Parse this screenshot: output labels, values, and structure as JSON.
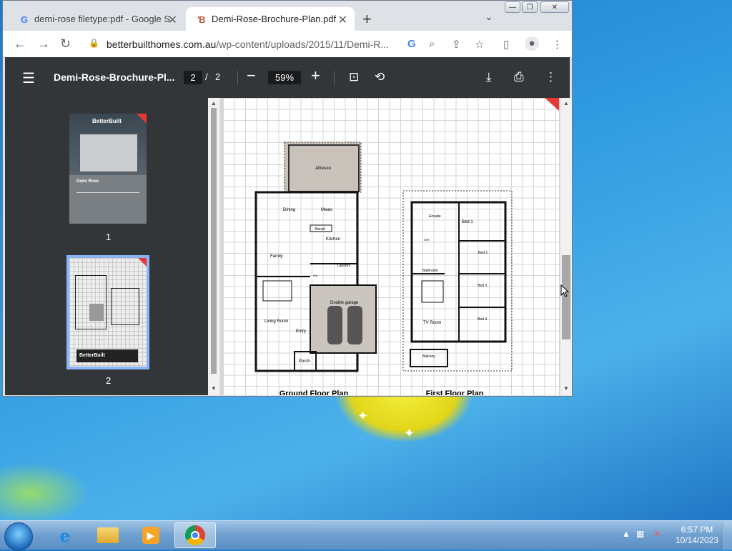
{
  "browser": {
    "tabs": [
      {
        "label": "demi-rose filetype:pdf - Google S",
        "favicon": "google-icon",
        "active": false
      },
      {
        "label": "Demi-Rose-Brochure-Plan.pdf",
        "favicon": "pdf-favicon-icon",
        "active": true
      }
    ],
    "new_tab": "+",
    "url_domain": "betterbuilthomes.com.au",
    "url_path": "/wp-content/uploads/2015/11/Demi-R..."
  },
  "pdf": {
    "title": "Demi-Rose-Brochure-Pl...",
    "current_page": "2",
    "page_separator": "/",
    "total_pages": "2",
    "zoom": "59%",
    "thumbnails": [
      {
        "label": "1",
        "brand": "BetterBuilt",
        "name": "Demi Rose"
      },
      {
        "label": "2",
        "brand": "BetterBuilt"
      }
    ],
    "plan_labels": {
      "alfresco": "Alfresco",
      "dining": "Dining",
      "meals": "Meals",
      "bench": "Bench",
      "kitchen": "Kitchen",
      "family": "Family",
      "laundry": "Laundry",
      "pdr": "Pdr",
      "double_garage": "Double garage",
      "living_room": "Living Room",
      "entry": "Entry",
      "porch": "Porch",
      "ensuite": "Ensuite",
      "wir": "WIR",
      "bed1": "Bed 1",
      "bed2": "Bed 2",
      "bed3": "Bed 3",
      "bed4": "Bed 4",
      "bathroom": "Bathroom",
      "tv_room": "TV Room",
      "balcony": "Balcony",
      "ground_floor_title": "Ground Floor Plan",
      "first_floor_title": "First Floor Plan"
    }
  },
  "taskbar": {
    "time": "6:57 PM",
    "date": "10/14/2023",
    "apps": [
      {
        "name": "internet-explorer",
        "icon": "e"
      },
      {
        "name": "file-explorer",
        "icon": "folder"
      },
      {
        "name": "media-player",
        "icon": "play"
      },
      {
        "name": "chrome",
        "icon": "chrome",
        "active": true
      }
    ]
  },
  "colors": {
    "pdf_toolbar": "#323639",
    "garage_fill": "#cbc5bf",
    "alfresco_fill": "#c9c2bb",
    "thumbnail_selected": "#8ab4f8"
  }
}
